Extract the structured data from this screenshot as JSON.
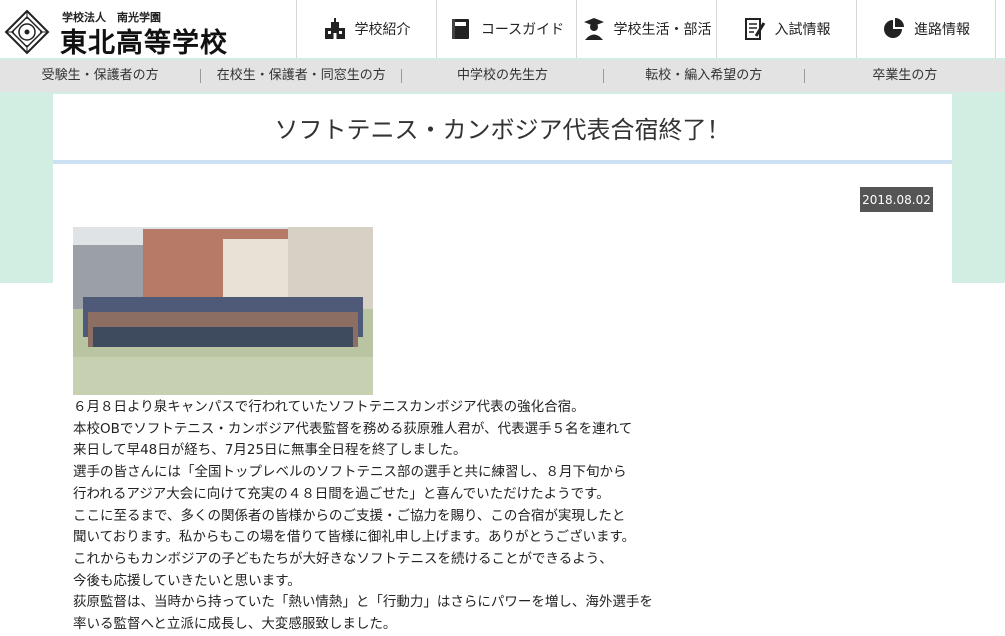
{
  "header": {
    "school_small": "学校法人　南光学園",
    "school_name": "東北高等学校",
    "nav": [
      {
        "label": "学校紹介",
        "icon": "school-building-icon"
      },
      {
        "label": "コースガイド",
        "icon": "book-icon"
      },
      {
        "label": "学校生活・部活",
        "icon": "student-icon"
      },
      {
        "label": "入試情報",
        "icon": "document-pen-icon"
      },
      {
        "label": "進路情報",
        "icon": "pie-chart-icon"
      }
    ]
  },
  "subnav": [
    "受験生・保護者の方",
    "在校生・保護者・同窓生の方",
    "中学校の先生方",
    "転校・編入希望の方",
    "卒業生の方"
  ],
  "article": {
    "title": "ソフトテニス・カンボジア代表合宿終了！",
    "date": "2018.08.02",
    "lines": [
      "６月８日より泉キャンパスで行われていたソフトテニスカンボジア代表の強化合宿。",
      "本校OBでソフトテニス・カンボジア代表監督を務める荻原雅人君が、代表選手５名を連れて",
      "来日して早48日が経ち、7月25日に無事全日程を終了しました。",
      "選手の皆さんには「全国トップレベルのソフトテニス部の選手と共に練習し、８月下旬から",
      "行われるアジア大会に向けて充実の４８日間を過ごせた」と喜んでいただけたようです。",
      "ここに至るまで、多くの関係者の皆様からのご支援・ご協力を賜り、この合宿が実現したと",
      "聞いております。私からもこの場を借りて皆様に御礼申し上げます。ありがとうございます。",
      "これからもカンボジアの子どもたちが大好きなソフトテニスを続けることができるよう、",
      "今後も応援していきたいと思います。",
      "荻原監督は、当時から持っていた「熱い情熱」と「行動力」はさらにパワーを増し、海外選手を",
      "率いる監督へと立派に成長し、大変感服致しました。"
    ]
  },
  "colors": {
    "mint": "#d2ede2",
    "title_underline": "#cbe1f3",
    "date_badge": "#555555"
  }
}
